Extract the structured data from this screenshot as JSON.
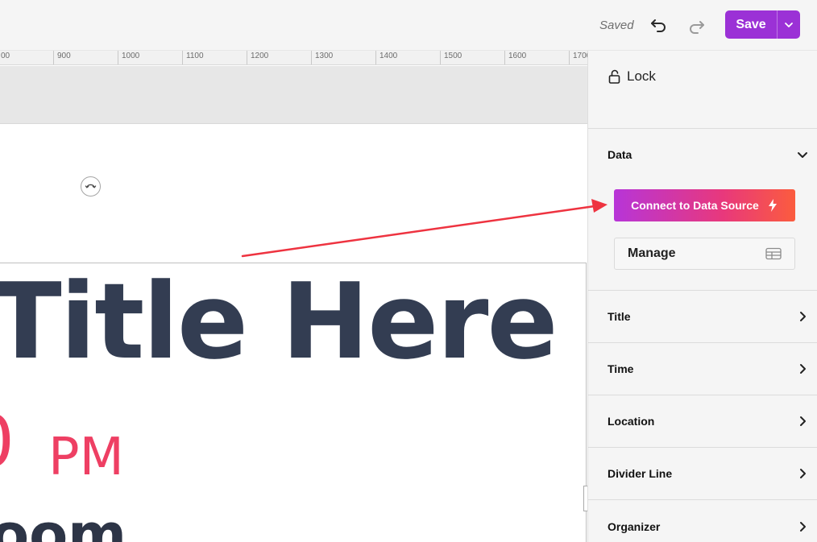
{
  "toolbar": {
    "status": "Saved",
    "undo_icon": "undo-icon",
    "redo_icon": "redo-icon",
    "save_label": "Save",
    "save_color": "#9b31d6"
  },
  "ruler": {
    "ticks": [
      "900",
      "1000",
      "1100",
      "1200",
      "1300",
      "1400",
      "1500",
      "1600",
      "1700"
    ],
    "partial_left": "00"
  },
  "canvas": {
    "title": "Title Here",
    "time_number": "0",
    "time_suffix": "PM",
    "location_partial": "oom",
    "title_color": "#333d52",
    "accent_color": "#ee3f63"
  },
  "panel": {
    "lock_label": "Lock",
    "sections": {
      "data": "Data",
      "title": "Title",
      "time": "Time",
      "location": "Location",
      "divider": "Divider Line",
      "organizer": "Organizer"
    },
    "connect_label": "Connect to Data Source",
    "manage_label": "Manage"
  },
  "annotation": {
    "arrow_color": "#ee3340"
  }
}
